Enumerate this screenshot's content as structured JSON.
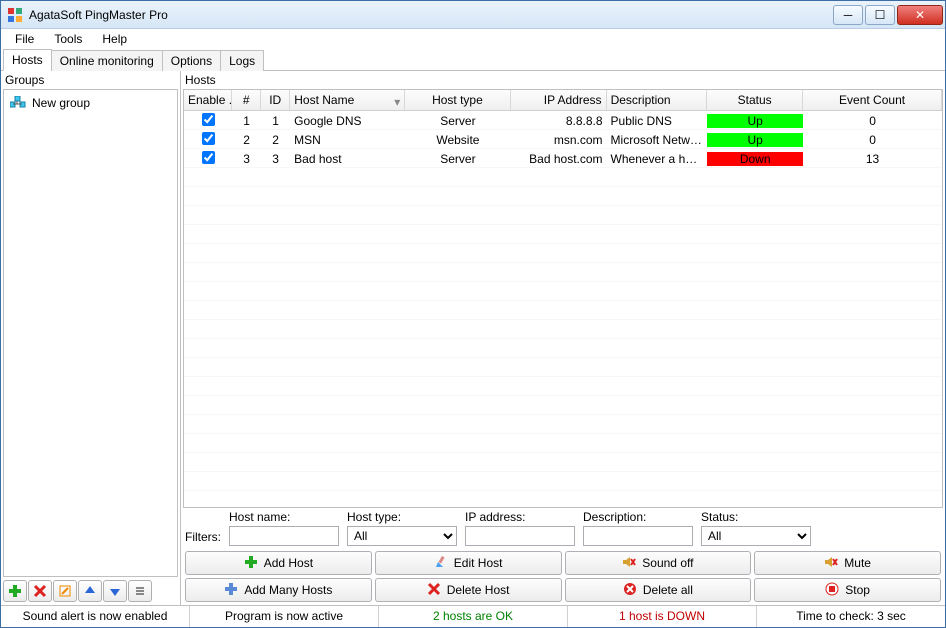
{
  "title": "AgataSoft PingMaster Pro",
  "menu": {
    "file": "File",
    "tools": "Tools",
    "help": "Help"
  },
  "tabs": {
    "hosts": "Hosts",
    "online": "Online monitoring",
    "options": "Options",
    "logs": "Logs"
  },
  "panels": {
    "groups": "Groups",
    "hosts": "Hosts"
  },
  "tree": {
    "group0": "New group"
  },
  "columns": {
    "enable": "Enable ...",
    "num": "#",
    "id": "ID",
    "host_name": "Host Name",
    "host_type": "Host type",
    "ip": "IP Address",
    "desc": "Description",
    "status": "Status",
    "events": "Event Count"
  },
  "rows": [
    {
      "enabled": true,
      "num": "1",
      "id": "1",
      "name": "Google DNS",
      "type": "Server",
      "ip": "8.8.8.8",
      "desc": "Public DNS",
      "status": "Up",
      "status_class": "status-up",
      "events": "0"
    },
    {
      "enabled": true,
      "num": "2",
      "id": "2",
      "name": "MSN",
      "type": "Website",
      "ip": "msn.com",
      "desc": "Microsoft Network ...",
      "status": "Up",
      "status_class": "status-up",
      "events": "0"
    },
    {
      "enabled": true,
      "num": "3",
      "id": "3",
      "name": "Bad host",
      "type": "Server",
      "ip": "Bad host.com",
      "desc": "Whenever a host is...",
      "status": "Down",
      "status_class": "status-down",
      "events": "13"
    }
  ],
  "filters": {
    "label": "Filters:",
    "host_name": "Host name:",
    "host_type": "Host type:",
    "ip": "IP address:",
    "desc": "Description:",
    "status": "Status:",
    "all": "All"
  },
  "buttons": {
    "add_host": "Add Host",
    "edit_host": "Edit Host",
    "sound_off": "Sound off",
    "mute": "Mute",
    "add_many": "Add Many Hosts",
    "delete_host": "Delete Host",
    "delete_all": "Delete all",
    "stop": "Stop"
  },
  "statusbar": {
    "sound": "Sound alert is now enabled",
    "active": "Program is now active",
    "ok": "2 hosts are OK",
    "down": "1 host is DOWN",
    "timer": "Time to check: 3 sec"
  }
}
